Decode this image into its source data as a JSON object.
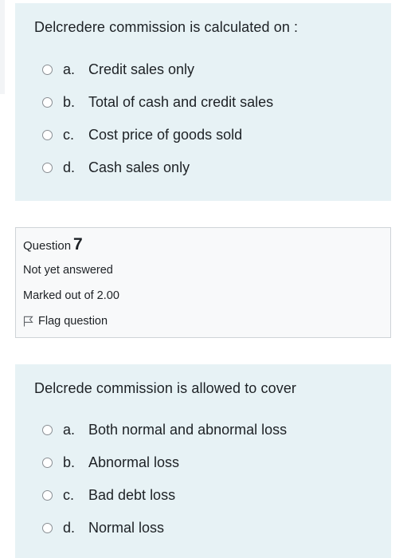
{
  "question_a": {
    "text": "Delcredere  commission is calculated on :",
    "answers": [
      {
        "letter": "a.",
        "label": "Credit sales only"
      },
      {
        "letter": "b.",
        "label": "Total of cash and credit sales"
      },
      {
        "letter": "c.",
        "label": "Cost price of goods sold"
      },
      {
        "letter": "d.",
        "label": "Cash sales only"
      }
    ]
  },
  "info": {
    "question_label": "Question",
    "question_number": "7",
    "state": "Not yet answered",
    "grade": "Marked out of 2.00",
    "flag_label": "Flag question"
  },
  "question_b": {
    "text": "Delcrede commission is allowed to cover",
    "answers": [
      {
        "letter": "a.",
        "label": "Both normal and abnormal loss"
      },
      {
        "letter": "b.",
        "label": "Abnormal loss"
      },
      {
        "letter": "c.",
        "label": "Bad debt loss"
      },
      {
        "letter": "d.",
        "label": "Normal loss"
      }
    ]
  },
  "colors": {
    "qtext_background": "#e7f2f5",
    "info_background": "#f8f9fa",
    "text": "#1d2125"
  }
}
